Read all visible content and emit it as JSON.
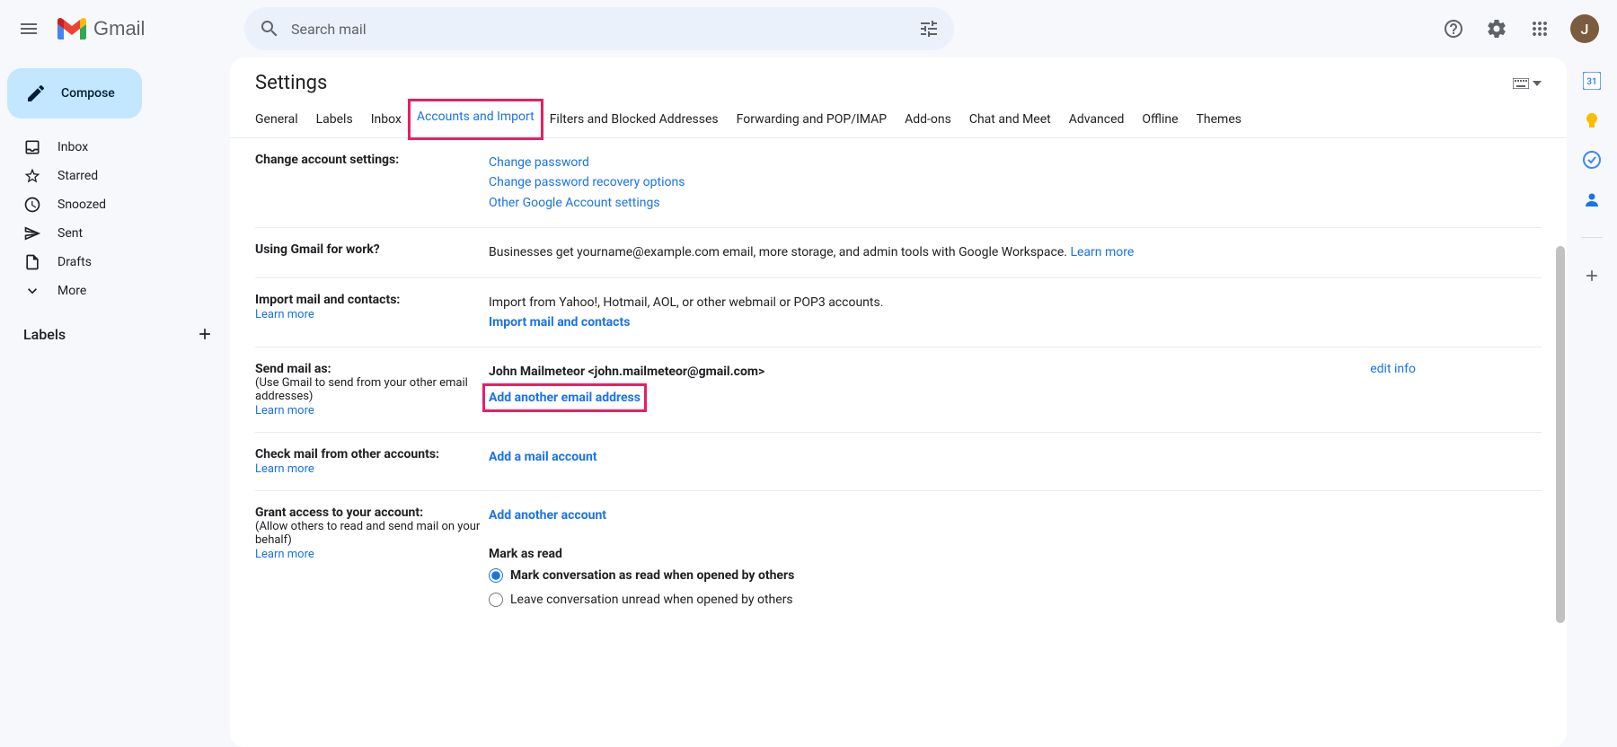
{
  "header": {
    "brand": "Gmail",
    "search_placeholder": "Search mail",
    "avatar_initial": "J"
  },
  "compose_label": "Compose",
  "nav": {
    "inbox": "Inbox",
    "starred": "Starred",
    "snoozed": "Snoozed",
    "sent": "Sent",
    "drafts": "Drafts",
    "more": "More"
  },
  "labels_header": "Labels",
  "settings": {
    "title": "Settings",
    "tabs": {
      "general": "General",
      "labels": "Labels",
      "inbox": "Inbox",
      "accounts_import": "Accounts and Import",
      "filters": "Filters and Blocked Addresses",
      "forwarding": "Forwarding and POP/IMAP",
      "addons": "Add-ons",
      "chat_meet": "Chat and Meet",
      "advanced": "Advanced",
      "offline": "Offline",
      "themes": "Themes"
    },
    "sections": {
      "change_account": {
        "label": "Change account settings:",
        "change_password": "Change password",
        "recovery": "Change password recovery options",
        "other": "Other Google Account settings"
      },
      "work": {
        "label": "Using Gmail for work?",
        "text": "Businesses get yourname@example.com email, more storage, and admin tools with Google Workspace. ",
        "learn_more": "Learn more"
      },
      "import": {
        "label": "Import mail and contacts:",
        "learn_more": "Learn more",
        "text": "Import from Yahoo!, Hotmail, AOL, or other webmail or POP3 accounts.",
        "action": "Import mail and contacts"
      },
      "send_as": {
        "label": "Send mail as:",
        "sublabel": "(Use Gmail to send from your other email addresses)",
        "learn_more": "Learn more",
        "identity": "John Mailmeteor <john.mailmeteor@gmail.com>",
        "add_link": "Add another email address",
        "edit_info": "edit info"
      },
      "check_mail": {
        "label": "Check mail from other accounts:",
        "learn_more": "Learn more",
        "action": "Add a mail account"
      },
      "grant_access": {
        "label": "Grant access to your account:",
        "sublabel": "(Allow others to read and send mail on your behalf)",
        "learn_more": "Learn more",
        "action": "Add another account",
        "mark_read_header": "Mark as read",
        "option1": "Mark conversation as read when opened by others",
        "option2": "Leave conversation unread when opened by others"
      }
    }
  }
}
